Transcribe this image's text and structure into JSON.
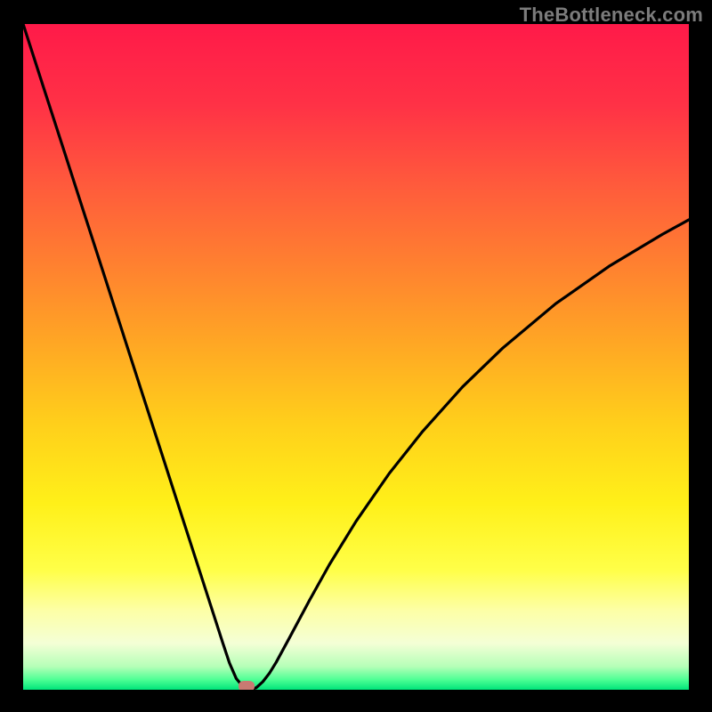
{
  "watermark": "TheBottleneck.com",
  "colors": {
    "background": "#000000",
    "marker": "#c87a72",
    "curve": "#000000",
    "gradient_stops": [
      {
        "offset": 0.0,
        "color": "#ff1a49"
      },
      {
        "offset": 0.12,
        "color": "#ff3146"
      },
      {
        "offset": 0.24,
        "color": "#ff5a3c"
      },
      {
        "offset": 0.36,
        "color": "#ff8030"
      },
      {
        "offset": 0.48,
        "color": "#ffa724"
      },
      {
        "offset": 0.6,
        "color": "#ffcf1b"
      },
      {
        "offset": 0.72,
        "color": "#fff019"
      },
      {
        "offset": 0.82,
        "color": "#ffff48"
      },
      {
        "offset": 0.88,
        "color": "#fdffa5"
      },
      {
        "offset": 0.93,
        "color": "#f4ffd6"
      },
      {
        "offset": 0.965,
        "color": "#b6ffb8"
      },
      {
        "offset": 0.985,
        "color": "#4dff94"
      },
      {
        "offset": 1.0,
        "color": "#00e47a"
      }
    ]
  },
  "chart_data": {
    "type": "line",
    "title": "",
    "xlabel": "",
    "ylabel": "",
    "xlim": [
      0,
      100
    ],
    "ylim": [
      0,
      100
    ],
    "x": [
      0,
      3,
      6,
      9,
      12,
      15,
      18,
      21,
      24,
      27,
      30,
      31,
      32,
      33,
      34,
      35,
      36,
      37,
      38,
      40,
      43,
      46,
      50,
      55,
      60,
      66,
      72,
      80,
      88,
      96,
      100
    ],
    "values": [
      100,
      90.7,
      81.4,
      72.1,
      62.8,
      53.5,
      44.2,
      34.9,
      25.6,
      16.3,
      7.0,
      4.0,
      1.7,
      0.5,
      0.0,
      0.3,
      1.2,
      2.5,
      4.1,
      7.8,
      13.4,
      18.8,
      25.3,
      32.5,
      38.8,
      45.5,
      51.3,
      58.0,
      63.6,
      68.4,
      70.6
    ],
    "marker": {
      "x": 33.5,
      "y": 0
    },
    "grid": false,
    "legend": false,
    "annotations": []
  }
}
